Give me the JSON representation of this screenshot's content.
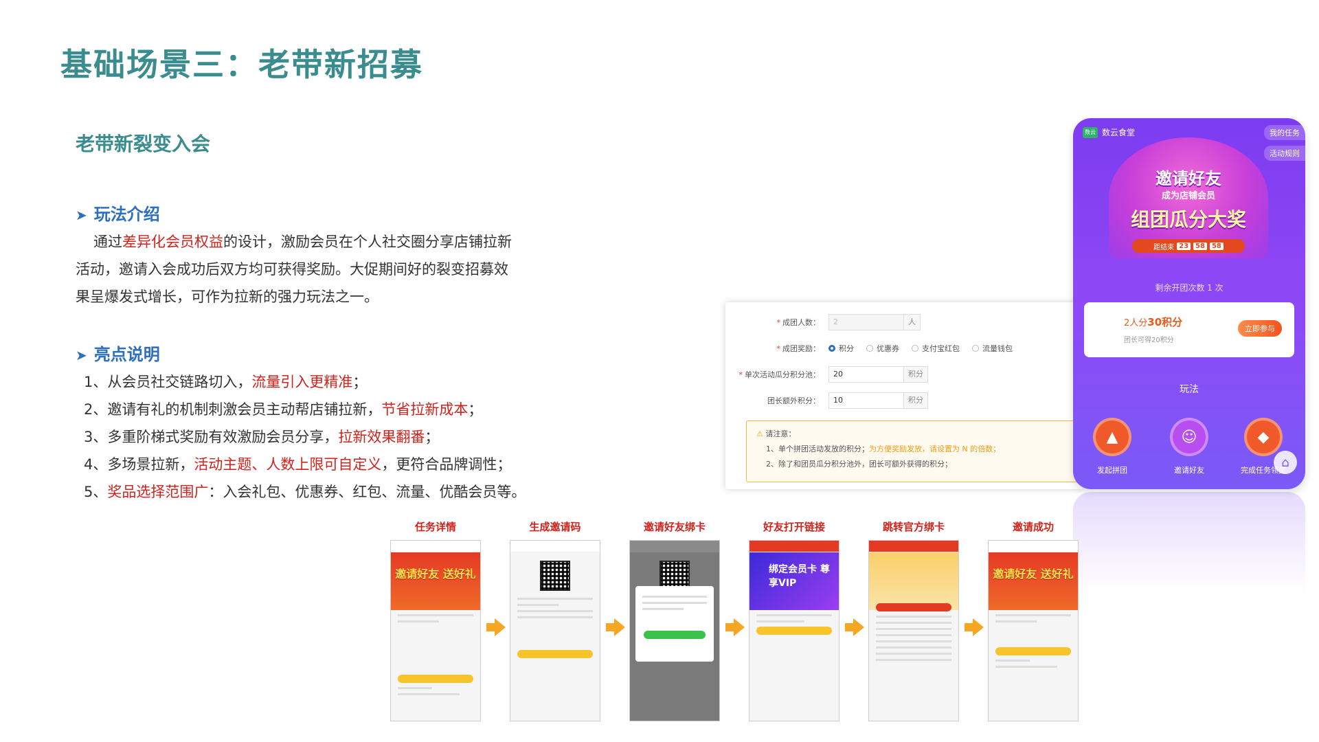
{
  "title": "基础场景三：老带新招募",
  "subtitle": "老带新裂变入会",
  "intro": {
    "heading": "玩法介绍",
    "text_pre": "通过",
    "text_red": "差异化会员权益",
    "text_post": "的设计，激励会员在个人社交圈分享店铺拉新活动，邀请入会成功后双方均可获得奖励。大促期间好的裂变招募效果呈爆发式增长，可作为拉新的强力玩法之一。"
  },
  "highlights": {
    "heading": "亮点说明",
    "items": [
      {
        "pre": "1、从会员社交链路切入，",
        "red": "流量引入更精准",
        "post": "；"
      },
      {
        "pre": "2、邀请有礼的机制刺激会员主动帮店铺拉新，",
        "red": "节省拉新成本",
        "post": "；"
      },
      {
        "pre": "3、多重阶梯式奖励有效激励会员分享，",
        "red": "拉新效果翻番",
        "post": "；"
      },
      {
        "pre": "4、多场景拉新，",
        "red": "活动主题、人数上限可自定义",
        "post": "，更符合品牌调性；"
      },
      {
        "pre": "5、",
        "red": "奖品选择范围广",
        "post": "：入会礼包、优惠券、红包、流量、优酷会员等。"
      }
    ]
  },
  "admin_form": {
    "group_size_label": "成团人数：",
    "group_size_value": "2",
    "group_size_unit": "人",
    "reward_label": "成团奖励：",
    "reward_options": [
      "积分",
      "优惠券",
      "支付宝红包",
      "流量钱包"
    ],
    "pool_label": "单次活动瓜分积分池：",
    "pool_value": "20",
    "pool_unit": "积分",
    "leader_label": "团长额外积分：",
    "leader_value": "10",
    "leader_unit": "积分",
    "notice_title": "请注意：",
    "notice_1_pre": "1、单个拼团活动发放的积分；",
    "notice_1_orange": "为方便奖励发放，请设置为 N 的倍数；",
    "notice_2": "2、除了和团员瓜分积分池外，团长可额外获得的积分；"
  },
  "phone": {
    "brand": "数云食堂",
    "brand_logo": "数云",
    "my_task": "我的任务",
    "rules": "活动规则",
    "banner_line1": "邀请好友",
    "banner_line2": "成为店铺会员",
    "banner_line3": "组团瓜分大奖",
    "countdown_label": "距结束",
    "countdown": [
      "23",
      "58",
      "58"
    ],
    "remaining": "剩余开团次数 1 次",
    "prize_pre": "2人分",
    "prize_amount": "30积分",
    "prize_sub": "团长可得20积分",
    "join": "立即参与",
    "play": "玩法",
    "actions": [
      {
        "label": "发起拼团",
        "icon": "shopping-bag-icon",
        "color": "#f0592a"
      },
      {
        "label": "邀请好友",
        "icon": "user-add-icon",
        "color": "#b84ef0"
      },
      {
        "label": "完成任务领奖",
        "icon": "gift-icon",
        "color": "#f0592a"
      }
    ]
  },
  "flow": {
    "steps": [
      {
        "label": "任务详情",
        "banner": "邀请好友 送好礼"
      },
      {
        "label": "生成邀请码",
        "banner": ""
      },
      {
        "label": "邀请好友绑卡",
        "banner": ""
      },
      {
        "label": "好友打开链接",
        "banner": "绑定会员卡 尊享VIP"
      },
      {
        "label": "跳转官方绑卡",
        "banner": ""
      },
      {
        "label": "邀请成功",
        "banner": "邀请好友 送好礼"
      }
    ]
  },
  "colors": {
    "title": "#3a8c8f",
    "heading": "#2c6fbe",
    "highlight": "#d0231c",
    "arrow": "#f5a623"
  }
}
